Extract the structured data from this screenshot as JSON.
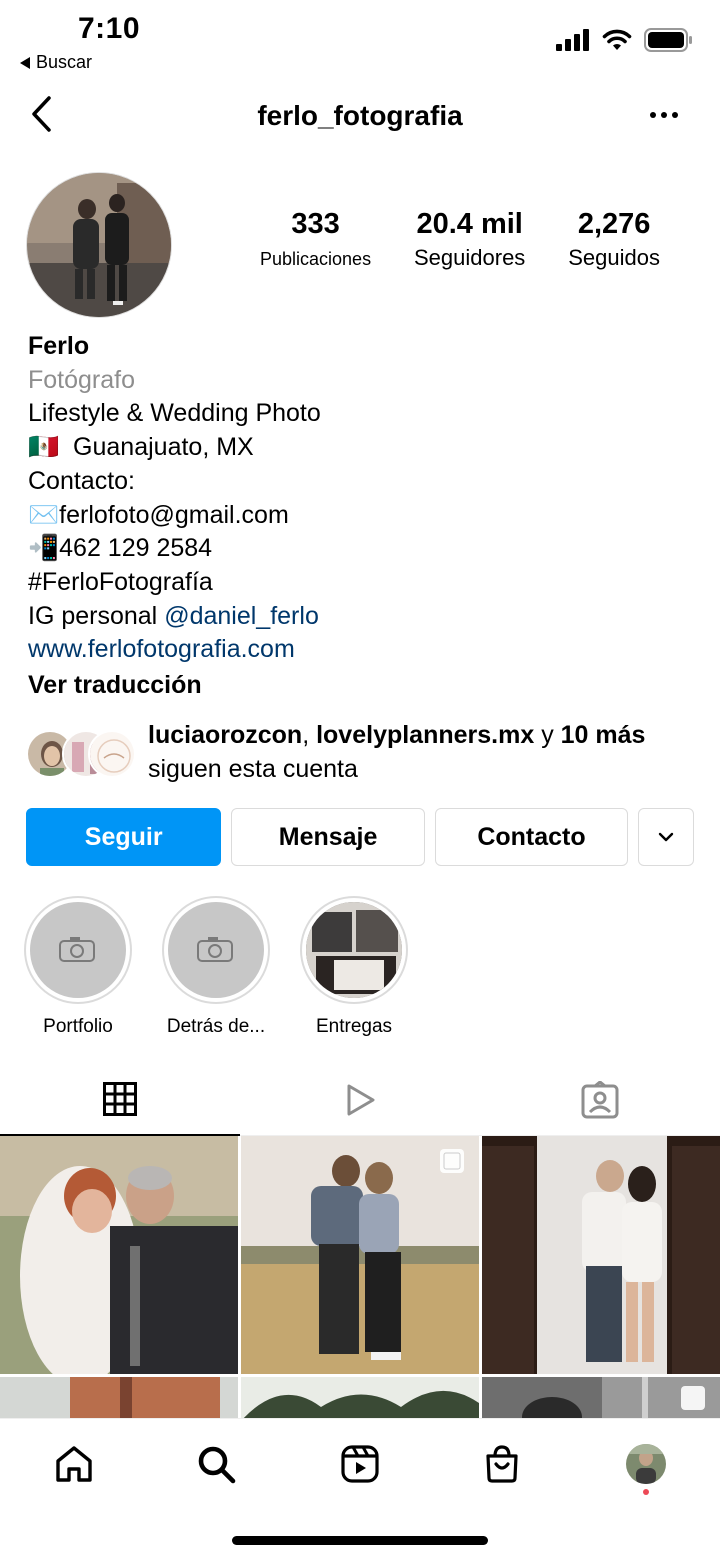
{
  "status_bar": {
    "time": "7:10",
    "back_app_label": "Buscar",
    "icons": [
      "signal-icon",
      "wifi-icon",
      "battery-icon"
    ]
  },
  "header": {
    "username": "ferlo_fotografia",
    "icons": [
      "back-chevron-icon",
      "more-icon"
    ]
  },
  "stats": [
    {
      "number": "333",
      "label": "Publicaciones"
    },
    {
      "number": "20.4 mil",
      "label": "Seguidores"
    },
    {
      "number": "2,276",
      "label": "Seguidos"
    }
  ],
  "bio": {
    "name": "Ferlo",
    "category": "Fotógrafo",
    "line1": "Lifestyle & Wedding Photo",
    "location_flag": "🇲🇽",
    "location": "Guanajuato, MX",
    "contact_label": "Contacto:",
    "email_emoji": "✉️",
    "email": "ferlofoto@gmail.com",
    "phone_emoji": "📲",
    "phone": "462 129 2584",
    "hashtag": "#FerloFotografía",
    "personal_prefix": "IG personal",
    "personal_handle": "@daniel_ferlo",
    "website": "www.ferlofotografia.com",
    "translate": "Ver traducción"
  },
  "followed_by": {
    "user1": "luciaorozcon",
    "separator": ",",
    "user2": "lovelyplanners.mx",
    "connector": "y",
    "more": "10 más",
    "suffix": "siguen esta cuenta"
  },
  "actions": {
    "follow": "Seguir",
    "message": "Mensaje",
    "contact": "Contacto"
  },
  "highlights": [
    {
      "label": "Portfolio"
    },
    {
      "label": "Detrás de..."
    },
    {
      "label": "Entregas"
    }
  ],
  "tabs": [
    "grid-icon",
    "reels-icon",
    "tagged-icon"
  ],
  "bottom_nav": [
    "home-icon",
    "search-icon",
    "reels-icon",
    "shop-icon",
    "profile-avatar"
  ],
  "colors": {
    "primary_button": "#0095f6",
    "link": "#00376b",
    "secondary_text": "#8e8e8e",
    "notification_dot": "#ed4956"
  }
}
